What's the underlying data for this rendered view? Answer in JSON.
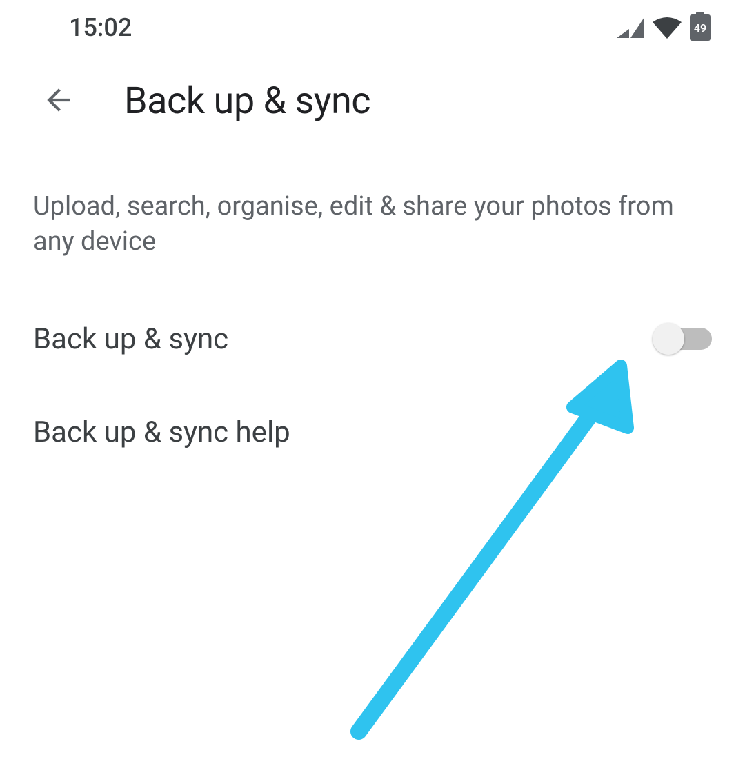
{
  "statusBar": {
    "time": "15:02",
    "batteryLevel": "49"
  },
  "appBar": {
    "title": "Back up & sync"
  },
  "content": {
    "description": "Upload, search, organise, edit & share your photos from any device",
    "backupSync": {
      "label": "Back up & sync",
      "enabled": false
    },
    "helpLabel": "Back up & sync help"
  },
  "annotation": {
    "arrowColor": "#2fc3ef"
  }
}
